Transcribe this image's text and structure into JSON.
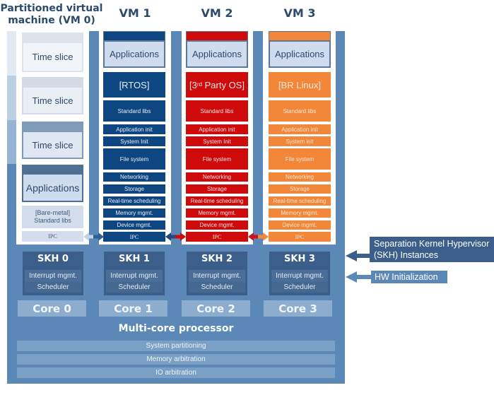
{
  "vm0": {
    "title_line1": "Partitioned virtual",
    "title_line2": "machine (VM 0)",
    "time_slices": [
      "Time slice",
      "Time slice",
      "Time slice"
    ],
    "applications": "Applications",
    "bare_metal_line1": "[Bare-metal]",
    "bare_metal_line2": "Standard libs",
    "ipc": "IPC"
  },
  "vms": [
    {
      "title": "VM 1",
      "accent_color": "#0d4680",
      "applications": "Applications",
      "os": {
        "pre": "[RTOS]",
        "sup": "",
        "post": ""
      },
      "layers": [
        "Standard libs",
        "Application init",
        "System Init",
        "File system",
        "Networking",
        "Storage",
        "Real-time scheduling",
        "Memory mgmt.",
        "Device mgmt."
      ],
      "ipc": "IPC"
    },
    {
      "title": "VM 2",
      "accent_color": "#cf0a0a",
      "applications": "Applications",
      "os": {
        "pre": "[3",
        "sup": "rd",
        "post": " Party OS]"
      },
      "layers": [
        "Standard libs",
        "Application init",
        "System Init",
        "File system",
        "Networking",
        "Storage",
        "Real-time scheduling",
        "Memory mgmt.",
        "Device mgmt."
      ],
      "ipc": "IPC"
    },
    {
      "title": "VM 3",
      "accent_color": "#f2873a",
      "applications": "Applications",
      "os": {
        "pre": "[BR Linux]",
        "sup": "",
        "post": ""
      },
      "layers": [
        "Standard libs",
        "Application init",
        "System init",
        "File system",
        "Networking",
        "Storage",
        "Real-time scheduling",
        "Memory mgmt.",
        "Device mgmt."
      ],
      "ipc": "IPC"
    }
  ],
  "skh": [
    {
      "title": "SKH 0",
      "rows": [
        "Interrupt mgmt.",
        "Scheduler"
      ]
    },
    {
      "title": "SKH 1",
      "rows": [
        "Interrupt mgmt.",
        "Scheduler"
      ]
    },
    {
      "title": "SKH 2",
      "rows": [
        "Interrupt mgmt.",
        "Scheduler"
      ]
    },
    {
      "title": "SKH 3",
      "rows": [
        "Interrupt mgmt.",
        "Scheduler"
      ]
    }
  ],
  "cores": [
    "Core 0",
    "Core 1",
    "Core 2",
    "Core 3"
  ],
  "processor": {
    "title": "Multi-core processor",
    "layers": [
      "System partitioning",
      "Memory arbitration",
      "IO arbitration"
    ]
  },
  "legend": {
    "skh_lines": [
      "Separation Kernel Hypervisor",
      "(SKH) Instances"
    ],
    "hw_label": "HW Initialization"
  },
  "colors": {
    "frame": "#5b88b6",
    "skh_box": "#3b5f8a",
    "core_box": "#8dadcf",
    "heading_text": "#2c4a6b"
  }
}
